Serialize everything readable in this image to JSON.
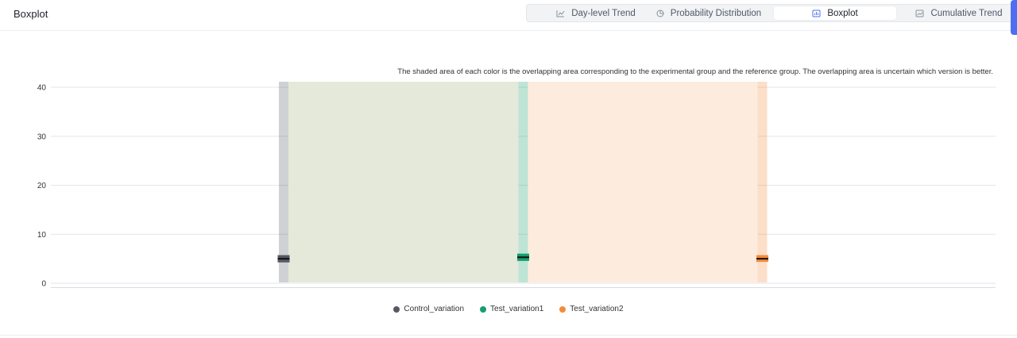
{
  "header": {
    "title": "Boxplot",
    "tabs": [
      {
        "label": "Day-level Trend",
        "icon": "line-chart-icon",
        "active": false
      },
      {
        "label": "Probability Distribution",
        "icon": "pie-chart-icon",
        "active": false
      },
      {
        "label": "Boxplot",
        "icon": "bar-chart-icon",
        "active": true
      },
      {
        "label": "Cumulative Trend",
        "icon": "area-chart-icon",
        "active": false
      }
    ]
  },
  "note": "The shaded area of each color is the overlapping area corresponding to the experimental group and the reference group. The overlapping area is uncertain which version is better.",
  "chart_data": {
    "type": "boxplot",
    "yticks": [
      0,
      10,
      20,
      30,
      40
    ],
    "ylim": [
      0,
      40
    ],
    "grid": true,
    "legend_position": "bottom",
    "series": [
      {
        "name": "Control_variation",
        "color": "#565964",
        "q1": 4.5,
        "median": 5,
        "q3": 5.5,
        "whisker_low": 0,
        "whisker_high": 40
      },
      {
        "name": "Test_variation1",
        "color": "#169e6d",
        "q1": 4.8,
        "median": 5.3,
        "q3": 5.8,
        "whisker_low": 0,
        "whisker_high": 40
      },
      {
        "name": "Test_variation2",
        "color": "#f48b3b",
        "q1": 4.6,
        "median": 5,
        "q3": 5.5,
        "whisker_low": 0,
        "whisker_high": 40
      }
    ],
    "overlap_regions": [
      {
        "from": "Control_variation",
        "to": "Test_variation1",
        "color": "#e4e9da"
      },
      {
        "from": "Test_variation1",
        "to": "Test_variation2",
        "color": "#fdebde"
      }
    ]
  }
}
